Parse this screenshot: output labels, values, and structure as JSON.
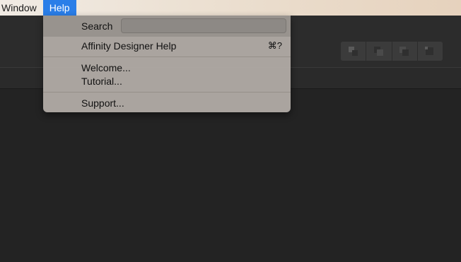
{
  "menubar": {
    "items": [
      {
        "label": "Window"
      },
      {
        "label": "Help"
      }
    ]
  },
  "help_menu": {
    "search_label": "Search",
    "search_value": "",
    "items": [
      {
        "label": "Affinity Designer Help",
        "shortcut": "⌘?"
      },
      {
        "label": "Welcome..."
      },
      {
        "label": "Tutorial..."
      },
      {
        "label": "Support..."
      }
    ]
  },
  "toolbar": {
    "arrange_buttons": [
      "arrange-back-icon",
      "arrange-backward-icon",
      "arrange-forward-icon",
      "arrange-front-icon"
    ]
  },
  "colors": {
    "menu_highlight": "#2a7ee8",
    "app_background": "#232323"
  }
}
